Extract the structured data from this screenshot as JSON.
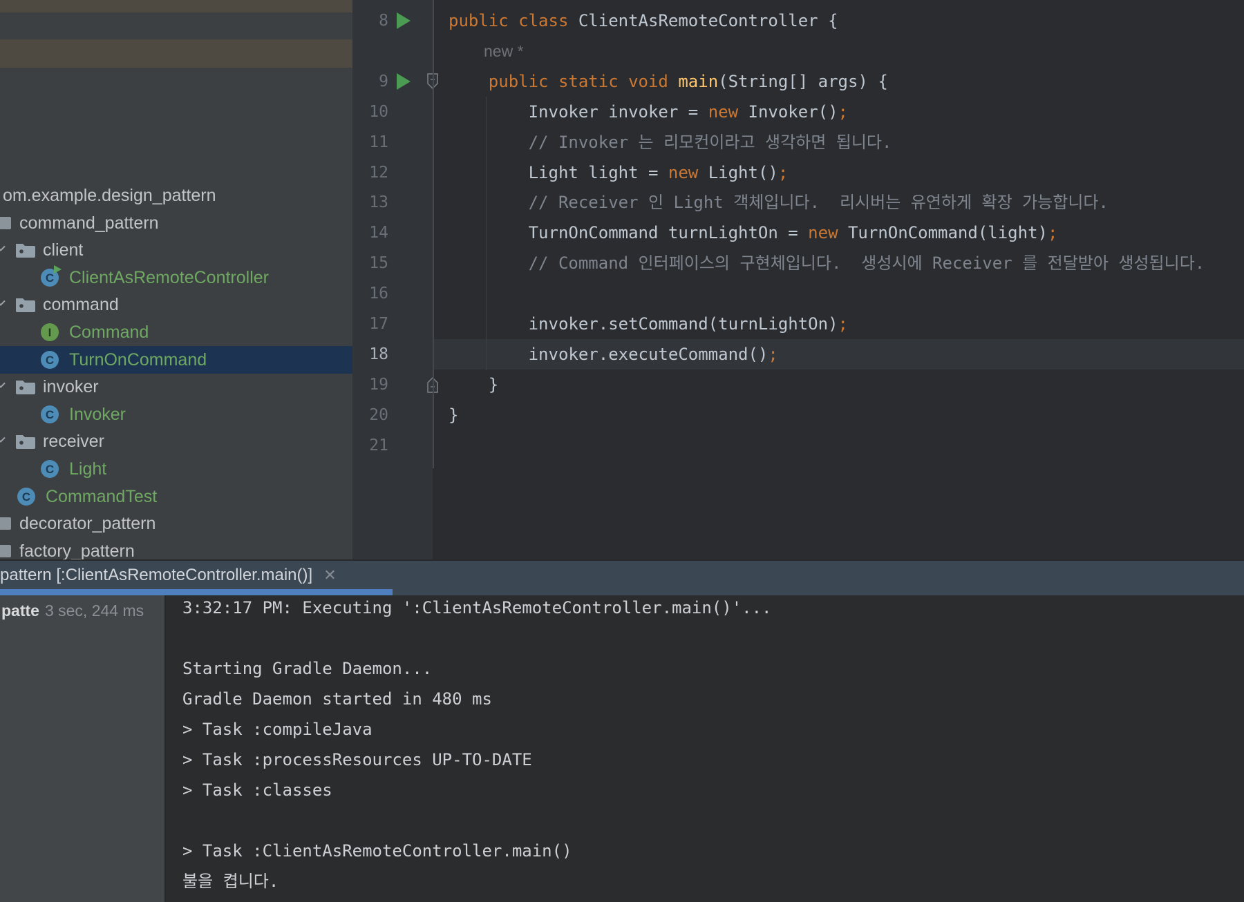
{
  "colors": {
    "kw": "#CC7832",
    "fn": "#FFC66D",
    "pl": "#BFC7D1",
    "cm": "#7F858E",
    "sc": "#CC7832",
    "tree_text": "#C2C4C6",
    "tree_class_text": "#6FA862",
    "selection_bg": "#1C3452",
    "run_green": "#4C9B52",
    "class_icon_blue": "#4E8CB8",
    "interface_icon_green": "#649A4D",
    "folder_icon": "#94A1AB",
    "package_icon": "#8B949B",
    "accent_underline": "#4E80BF",
    "editor_bg": "#2A2C2F",
    "gutter_bg": "#313438",
    "panel_bg": "#3D4043",
    "tabbar_bg": "#3C4754",
    "console_bg": "#2A2C2E"
  },
  "project_tree": {
    "items": [
      {
        "label": "om.example.design_pattern",
        "kind": "package-root",
        "level": 0
      },
      {
        "label": "command_pattern",
        "kind": "package",
        "level": 0
      },
      {
        "label": "client",
        "kind": "folder",
        "level": 1
      },
      {
        "label": "ClientAsRemoteController",
        "kind": "class-run",
        "level": 2
      },
      {
        "label": "command",
        "kind": "folder",
        "level": 1
      },
      {
        "label": "Command",
        "kind": "interface",
        "level": 2
      },
      {
        "label": "TurnOnCommand",
        "kind": "class",
        "level": 2,
        "selected": true
      },
      {
        "label": "invoker",
        "kind": "folder",
        "level": 1
      },
      {
        "label": "Invoker",
        "kind": "class",
        "level": 2
      },
      {
        "label": "receiver",
        "kind": "folder",
        "level": 1
      },
      {
        "label": "Light",
        "kind": "class",
        "level": 2
      },
      {
        "label": "CommandTest",
        "kind": "class",
        "level": 1
      },
      {
        "label": "decorator_pattern",
        "kind": "package",
        "level": 0
      },
      {
        "label": "factory_pattern",
        "kind": "package",
        "level": 0
      }
    ]
  },
  "editor": {
    "rows": [
      {
        "no": 8,
        "run": true,
        "tokens": [
          [
            "public class ",
            "kw"
          ],
          [
            "ClientAsRemoteController {",
            "pl"
          ]
        ]
      },
      {
        "inlay": "new *"
      },
      {
        "no": 9,
        "run": true,
        "fold": "start",
        "tokens": [
          [
            "    ",
            "pl"
          ],
          [
            "public static void ",
            "kw"
          ],
          [
            "main",
            "fn"
          ],
          [
            "(String[] args) {",
            "pl"
          ]
        ]
      },
      {
        "no": 10,
        "tokens": [
          [
            "        Invoker invoker = ",
            "pl"
          ],
          [
            "new",
            "kw"
          ],
          [
            " Invoker()",
            "pl"
          ],
          [
            ";",
            "sc"
          ]
        ]
      },
      {
        "no": 11,
        "tokens": [
          [
            "        ",
            "pl"
          ],
          [
            "// Invoker 는 리모컨이라고 생각하면 됩니다.",
            "cm"
          ]
        ]
      },
      {
        "no": 12,
        "tokens": [
          [
            "        Light light = ",
            "pl"
          ],
          [
            "new",
            "kw"
          ],
          [
            " Light()",
            "pl"
          ],
          [
            ";",
            "sc"
          ]
        ]
      },
      {
        "no": 13,
        "tokens": [
          [
            "        ",
            "pl"
          ],
          [
            "// Receiver 인 Light 객체입니다.  리시버는 유연하게 확장 가능합니다.",
            "cm"
          ]
        ]
      },
      {
        "no": 14,
        "tokens": [
          [
            "        TurnOnCommand turnLightOn = ",
            "pl"
          ],
          [
            "new",
            "kw"
          ],
          [
            " TurnOnCommand(light)",
            "pl"
          ],
          [
            ";",
            "sc"
          ]
        ]
      },
      {
        "no": 15,
        "tokens": [
          [
            "        ",
            "pl"
          ],
          [
            "// Command 인터페이스의 구현체입니다.  생성시에 Receiver 를 전달받아 생성됩니다.",
            "cm"
          ]
        ]
      },
      {
        "no": 16,
        "tokens": []
      },
      {
        "no": 17,
        "tokens": [
          [
            "        invoker.setCommand(turnLightOn)",
            "pl"
          ],
          [
            ";",
            "sc"
          ]
        ]
      },
      {
        "no": 18,
        "current": true,
        "tokens": [
          [
            "        invoker.executeCommand()",
            "pl"
          ],
          [
            ";",
            "sc"
          ]
        ]
      },
      {
        "no": 19,
        "fold": "end",
        "tokens": [
          [
            "    }",
            "pl"
          ]
        ]
      },
      {
        "no": 20,
        "tokens": [
          [
            "}",
            "pl"
          ]
        ]
      },
      {
        "no": 21,
        "tokens": []
      }
    ]
  },
  "run_tool_window": {
    "tab": {
      "title": "pattern [:ClientAsRemoteController.main()]",
      "close_label": "✕"
    },
    "node": {
      "name": "patte",
      "duration": "3 sec, 244 ms"
    },
    "console_lines": [
      "3:32:17 PM: Executing ':ClientAsRemoteController.main()'...",
      "",
      "Starting Gradle Daemon...",
      "Gradle Daemon started in 480 ms",
      "> Task :compileJava",
      "> Task :processResources UP-TO-DATE",
      "> Task :classes",
      "",
      "> Task :ClientAsRemoteController.main()",
      "불을 켭니다."
    ]
  }
}
